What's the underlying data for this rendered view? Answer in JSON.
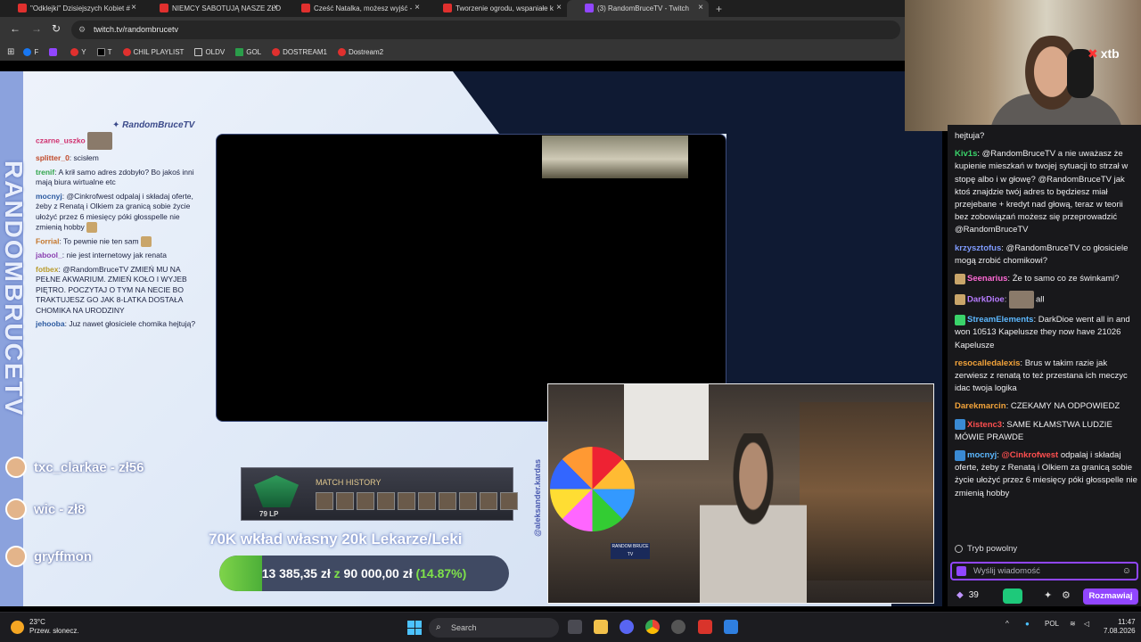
{
  "browser": {
    "tabs": [
      {
        "title": "\"Odklejki\" Dzisiejszych Kobiet #"
      },
      {
        "title": "NIEMCY SABOTUJĄ NASZE ZŁO"
      },
      {
        "title": "Cześć Natalka, możesz wyjść - "
      },
      {
        "title": "Tworzenie ogrodu, wspaniałe k"
      },
      {
        "title": "(3) RandomBruceTV - Twitch"
      }
    ],
    "url": "twitch.tv/randombrucetv",
    "bookmarks": [
      {
        "label": "F",
        "icon": "fb"
      },
      {
        "label": "",
        "icon": "tw"
      },
      {
        "label": "Y",
        "icon": "yt"
      },
      {
        "label": "T",
        "icon": "x"
      },
      {
        "label": "CHIL PLAYLIST",
        "icon": "yt"
      },
      {
        "label": "OLDV",
        "icon": "folder"
      },
      {
        "label": "GOL",
        "icon": "gol"
      },
      {
        "label": "DOSTREAM1",
        "icon": "yt"
      },
      {
        "label": "Dostream2",
        "icon": "yt"
      }
    ]
  },
  "overlay": {
    "vertical_name": "RANDOMBRUCETV",
    "channel_tag": "RandomBruceTV",
    "chat": [
      {
        "user": "czarne_uszko",
        "text": "",
        "color": "#d0306e"
      },
      {
        "user": "splitter_0",
        "text": "scisłem",
        "color": "#c04a2a"
      },
      {
        "user": "trenif",
        "text": "A krił samo adres zdobyło? Bo jakoś inni mają biura wirtualne etc",
        "color": "#2fa44a"
      },
      {
        "user": "mocnyj",
        "text": "@Cinkrofwest odpalaj i składaj oferte, żeby z Renatą i Olkiem za granicą sobie życie ułożyć przez 6 miesięcy póki głosspelle nie zmienią hobby",
        "color": "#2c5aa0"
      },
      {
        "user": "Forrial",
        "text": "To pewnie nie ten sam",
        "color": "#c4762a"
      },
      {
        "user": "jabool_",
        "text": "nie jest internetowy jak renata",
        "color": "#8a3fb0"
      },
      {
        "user": "fotbex",
        "text": "@RandomBruceTV ZMIEŃ MU NA PEŁNE AKWARIUM. ZMIEŃ KOŁO I WYJEB PIĘTRO. POCZYTAJ O TYM NA NECIE BO TRAKTUJESZ GO JAK 8-LATKA DOSTAŁA CHOMIKA NA URODZINY",
        "color": "#b89a2a"
      },
      {
        "user": "jehooba",
        "text": "Juz nawet głosiciele chomika hejtują?",
        "color": "#2c5aa0"
      }
    ],
    "donors": [
      {
        "text": "txc_clarkae - zł56"
      },
      {
        "text": "wic - zł8"
      },
      {
        "text": "gryffmon"
      }
    ],
    "match_history": {
      "title": "MATCH HISTORY",
      "lp": "79 LP"
    },
    "goal": {
      "title": "70K wkład własny 20k Lekarze/Leki",
      "current": "13 385,35 zł",
      "sep": "z",
      "target": "90 000,00 zł",
      "percent_label": "(14.87%)",
      "progress": 0.1487
    },
    "side_tag": "@aleksander.kardas",
    "cam_sign": "RANDOM BRUCE TV"
  },
  "webcam_top": {
    "brand": "xtb"
  },
  "twitch_chat": {
    "messages": [
      {
        "user": "",
        "user_color": "#efeff1",
        "text": "hejtuja?"
      },
      {
        "user": "Kiv1s",
        "user_color": "#3ad36a",
        "text": "@RandomBruceTV a nie uważasz że kupienie mieszkań w twojej sytuacji to strzał w stopę albo i w głowę? @RandomBruceTV jak ktoś znajdzie twój adres to będziesz miał przejebane + kredyt nad głową, teraz w teorii bez zobowiązań możesz się przeprowadzić @RandomBruceTV"
      },
      {
        "user": "krzysztofus",
        "user_color": "#7f9bff",
        "text": "@RandomBruceTV co głosiciele mogą zrobić chomikowi?"
      },
      {
        "user": "Seenarius",
        "user_color": "#ff6ad5",
        "text": "Że to samo co ze świnkami?"
      },
      {
        "user": "DarkDioe",
        "user_color": "#b77cff",
        "text": "all"
      },
      {
        "user": "StreamElements",
        "user_color": "#5cb8ff",
        "text": "DarkDioe went all in and won 10513 Kapelusze they now have 21026 Kapelusze"
      },
      {
        "user": "resocalledalexis",
        "user_color": "#f2a33a",
        "text": "Brus w takim razie jak zerwiesz z renatą to też przestana ich meczyc idac twoja logika"
      },
      {
        "user": "Darekmarcin",
        "user_color": "#f2a33a",
        "text": "CZEKAMY NA ODPOWIEDZ"
      },
      {
        "user": "Xistenc3",
        "user_color": "#ff4f4f",
        "text": "SAME KŁAMSTWA LUDZIE MÓWIE PRAWDE"
      },
      {
        "user": "mocnyj",
        "user_color": "#5cb8ff",
        "text": "odpalaj i składaj oferte, żeby z Renatą i Olkiem za granicą sobie życie ułożyć przez 6 miesięcy póki głosspelle nie zmienią hobby",
        "mention": "@Cinkrofwest"
      }
    ],
    "slow_mode": "Tryb powolny",
    "input_placeholder": "Wyślij wiadomość",
    "points": "39",
    "chat_button": "Rozmawiaj"
  },
  "taskbar": {
    "temp": "23°C",
    "weather": "Przew. słonecz.",
    "search": "Search",
    "lang": "POL",
    "time": "11:47",
    "date": "7.08.2026"
  }
}
